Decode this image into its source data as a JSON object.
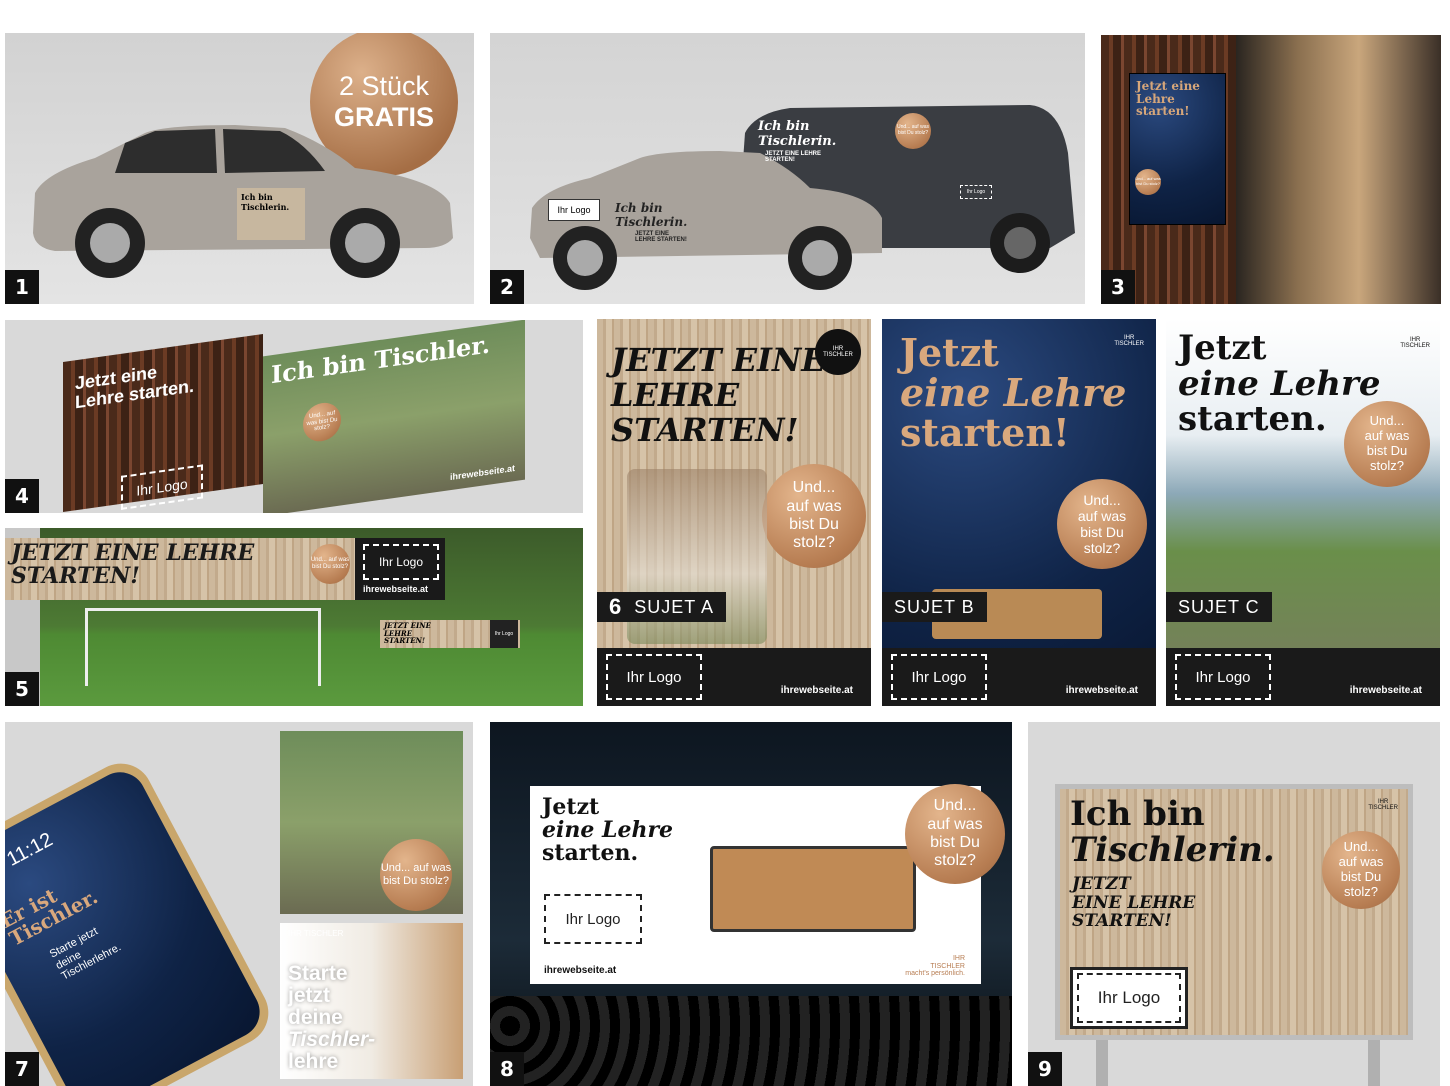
{
  "panels": {
    "p1": {
      "number": "1",
      "badge_line1": "2 Stück",
      "badge_line2": "GRATIS",
      "car_sticker": "Ich bin Tischlerin."
    },
    "p2": {
      "number": "2",
      "logo": "Ihr Logo",
      "car_headline": "Ich bin Tischlerin.",
      "car_sub": "JETZT EINE LEHRE STARTEN!",
      "van_headline": "Ich bin Tischlerin.",
      "van_sub": "JETZT EINE LEHRE STARTEN!",
      "bubble": "Und... auf was bist Du stolz?",
      "van_logo": "Ihr Logo"
    },
    "p3": {
      "number": "3",
      "poster_headline": "Jetzt eine Lehre starten!",
      "bubble": "Und... auf was bist Du stolz?"
    },
    "p4": {
      "number": "4",
      "left_headline": "Jetzt eine Lehre starten.",
      "right_headline": "Ich bin Tischler.",
      "bubble": "Und... auf was bist Du stolz?",
      "logo": "Ihr Logo",
      "website": "ihrewebseite.at"
    },
    "p5": {
      "number": "5",
      "headline": "JETZT EINE LEHRE STARTEN!",
      "bubble": "Und... auf was bist Du stolz?",
      "logo": "Ihr Logo",
      "website": "ihrewebseite.at",
      "small_headline": "JETZT EINE LEHRE STARTEN!",
      "small_logo": "Ihr Logo"
    },
    "p6a": {
      "number": "6",
      "sujet": "SUJET A",
      "headline": "JETZT EINE LEHRE STARTEN!",
      "bubble_1": "Und...",
      "bubble_2": "auf was",
      "bubble_3": "bist Du",
      "bubble_4": "stolz?",
      "logo": "Ihr Logo",
      "website": "ihrewebseite.at",
      "brand_1": "IHR",
      "brand_2": "TISCHLER"
    },
    "p6b": {
      "sujet": "SUJET B",
      "headline_1": "Jetzt",
      "headline_2": "eine Lehre",
      "headline_3": "starten!",
      "bubble_1": "Und...",
      "bubble_2": "auf was",
      "bubble_3": "bist Du",
      "bubble_4": "stolz?",
      "logo": "Ihr Logo",
      "website": "ihrewebseite.at",
      "brand_1": "IHR",
      "brand_2": "TISCHLER"
    },
    "p6c": {
      "sujet": "SUJET C",
      "headline_1": "Jetzt",
      "headline_2": "eine Lehre",
      "headline_3": "starten.",
      "bubble_1": "Und...",
      "bubble_2": "auf was",
      "bubble_3": "bist Du",
      "bubble_4": "stolz?",
      "logo": "Ihr Logo",
      "website": "ihrewebseite.at",
      "brand_1": "IHR",
      "brand_2": "TISCHLER"
    },
    "p7": {
      "number": "7",
      "phone_time": "11:12",
      "phone_headline": "Er ist Tischler.",
      "phone_sub": "Starte jetzt deine Tischlerlehre.",
      "bubble": "Und... auf was bist Du stolz?",
      "story_1": "Starte",
      "story_2": "jetzt",
      "story_3": "deine",
      "story_4": "Tischler-",
      "story_5": "lehre",
      "brand_1": "IHR",
      "brand_2": "TISCHLER"
    },
    "p8": {
      "number": "8",
      "headline_1": "Jetzt",
      "headline_2": "eine Lehre",
      "headline_3": "starten.",
      "bubble_1": "Und...",
      "bubble_2": "auf was",
      "bubble_3": "bist Du",
      "bubble_4": "stolz?",
      "logo": "Ihr Logo",
      "website": "ihrewebseite.at",
      "brand_1": "IHR",
      "brand_2": "TISCHLER",
      "brand_3": "macht's persönlich."
    },
    "p9": {
      "number": "9",
      "headline_1": "Ich bin",
      "headline_2": "Tischlerin.",
      "sub_1": "JETZT",
      "sub_2": "EINE LEHRE",
      "sub_3": "STARTEN!",
      "bubble_1": "Und...",
      "bubble_2": "auf was",
      "bubble_3": "bist Du",
      "bubble_4": "stolz?",
      "logo": "Ihr Logo",
      "brand_1": "IHR",
      "brand_2": "TISCHLER"
    }
  },
  "colors": {
    "copper": "#b77d52",
    "navy": "#0f2346",
    "dark": "#1a1a1a",
    "grey_bg": "#d9d9d9"
  }
}
